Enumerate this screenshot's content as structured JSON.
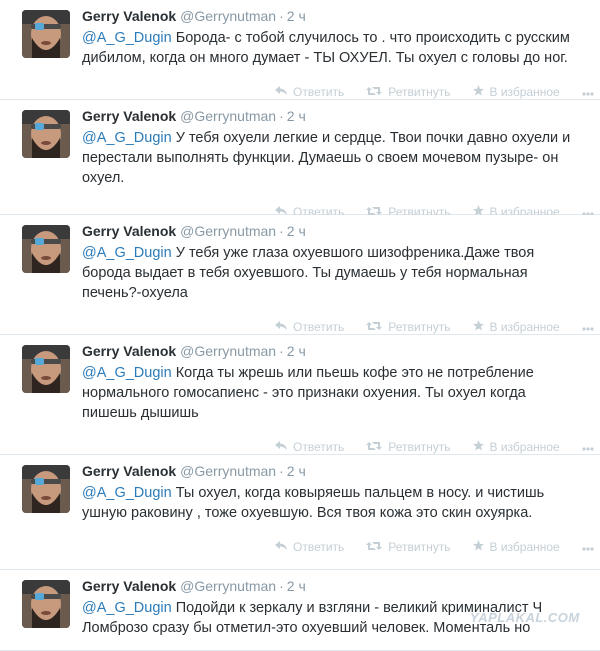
{
  "tweets": [
    {
      "name": "Gerry Valenok",
      "handle": "@Gerrynutman",
      "time": "2 ч",
      "mention": "@A_G_Dugin",
      "text": " Борода- с тобой случилось то . что происходить с русским\nдибилом, когда он много думает - ТЫ ОХУЕЛ. Ты охуел с головы до ног."
    },
    {
      "name": "Gerry Valenok",
      "handle": "@Gerrynutman",
      "time": "2 ч",
      "mention": "@A_G_Dugin",
      "text": " У тебя охуели легкие и сердце. Твои почки давно охуели и\nперестали выполнять функции. Думаешь о своем мочевом пузыре- он\nохуел."
    },
    {
      "name": "Gerry Valenok",
      "handle": "@Gerrynutman",
      "time": "2 ч",
      "mention": "@A_G_Dugin",
      "text": " У тебя уже глаза охуевшого шизофреника.Даже твоя\nборода выдает в тебя охуевшого. Ты думаешь у тебя нормальная\nпечень?-охуела"
    },
    {
      "name": "Gerry Valenok",
      "handle": "@Gerrynutman",
      "time": "2 ч",
      "mention": "@A_G_Dugin",
      "text": " Когда ты жрешь или пьешь кофе это не потребление\nнормального гомосапиенс - это признаки охуения. Ты охуел когда\nпишешь дышишь"
    },
    {
      "name": "Gerry Valenok",
      "handle": "@Gerrynutman",
      "time": "2 ч",
      "mention": "@A_G_Dugin",
      "text": " Ты охуел, когда ковыряешь пальцем в носу. и чистишь\nушную раковину , тоже охуевшую. Вся твоя кожа это скин охуярка."
    },
    {
      "name": "Gerry Valenok",
      "handle": "@Gerrynutman",
      "time": "2 ч",
      "mention": "@A_G_Dugin",
      "text": " Подойди к зеркалу и взгляни - великий криминалист Ч\nЛомброзо сразу бы отметил-это охуевший человек. Моменталь но"
    }
  ],
  "actions": {
    "reply": "Ответить",
    "retweet": "Ретвитнуть",
    "favorite": "В избранное",
    "more": "Ещё"
  },
  "colors": {
    "name": "#292f33",
    "meta": "#8899a6",
    "mention": "#2b7bb9",
    "action": "#c4cfd6"
  },
  "watermark": "YAPLAKAL.COM"
}
